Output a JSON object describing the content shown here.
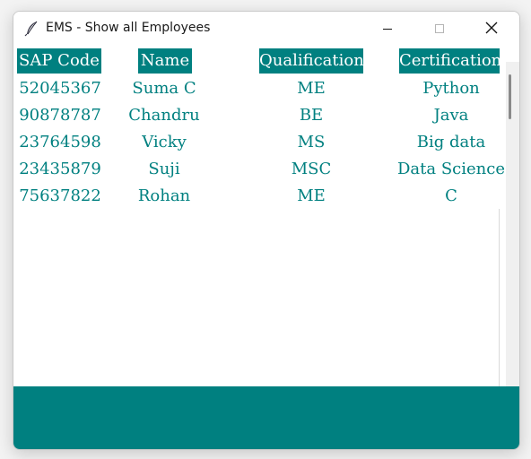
{
  "window": {
    "title": "EMS - Show all Employees"
  },
  "icons": {
    "app": "feather-icon",
    "minimize": "minimize-icon",
    "maximize": "maximize-icon",
    "close": "close-icon"
  },
  "colors": {
    "accent": "#008080",
    "header_text": "#ffffff"
  },
  "table": {
    "headers": [
      "SAP Code",
      "Name",
      "Qualification",
      "Certification"
    ],
    "rows": [
      [
        "52045367",
        "Suma C",
        "ME",
        "Python"
      ],
      [
        "90878787",
        "Chandru",
        "BE",
        "Java"
      ],
      [
        "23764598",
        "Vicky",
        "MS",
        "Big data"
      ],
      [
        "23435879",
        "Suji",
        "MSC",
        "Data Science"
      ],
      [
        "75637822",
        "Rohan",
        "ME",
        "C"
      ]
    ]
  }
}
